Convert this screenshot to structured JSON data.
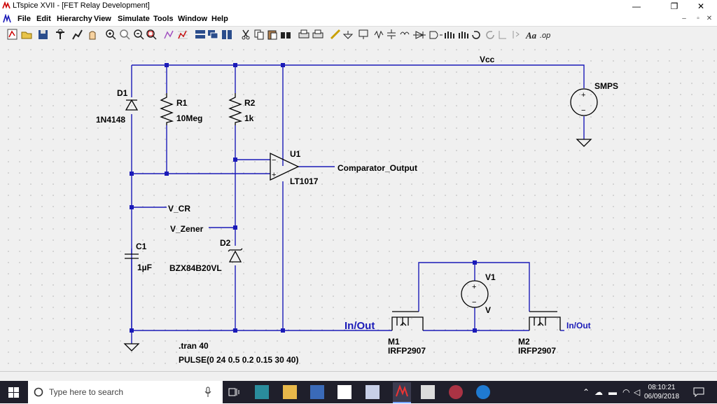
{
  "window": {
    "title": "LTspice XVII - [FET Relay Development]",
    "minimize": "—",
    "maximize": "❐",
    "close": "✕"
  },
  "menu": {
    "items": [
      "File",
      "Edit",
      "Hierarchy",
      "View",
      "Simulate",
      "Tools",
      "Window",
      "Help"
    ],
    "mdi_minimize": "–",
    "mdi_restore": "▫",
    "mdi_close": "✕"
  },
  "toolbar": {
    "icons": [
      "schematic-icon",
      "open-icon",
      "save-icon",
      "control-panel-icon",
      "run-icon",
      "halt-icon",
      "zoom-in-icon",
      "zoom-pan-icon",
      "zoom-out-icon",
      "zoom-fit-icon",
      "autorange-icon",
      "grid-icon",
      "tile-horizontal-icon",
      "cascade-icon",
      "tile-vertical-icon",
      "cut-icon",
      "copy-icon",
      "paste-icon",
      "find-icon",
      "print-setup-icon",
      "print-icon",
      "wire-icon",
      "ground-icon",
      "label-icon",
      "resistor-icon",
      "capacitor-icon",
      "inductor-icon",
      "diode-icon",
      "component-icon",
      "move-icon",
      "drag-icon",
      "undo-icon",
      "redo-icon",
      "rotate-icon",
      "mirror-icon",
      "text-icon",
      "spice-directive-icon"
    ]
  },
  "schematic": {
    "components": {
      "d1": {
        "ref": "D1",
        "value": "1N4148"
      },
      "r1": {
        "ref": "R1",
        "value": "10Meg"
      },
      "r2": {
        "ref": "R2",
        "value": "1k"
      },
      "u1": {
        "ref": "U1",
        "value": "LT1017"
      },
      "c1": {
        "ref": "C1",
        "value": "1µF"
      },
      "d2": {
        "ref": "D2",
        "value": "BZX84B20VL"
      },
      "smps": {
        "ref": "SMPS"
      },
      "v1": {
        "ref": "V1",
        "value": "V"
      },
      "m1": {
        "ref": "M1",
        "value": "IRFP2907"
      },
      "m2": {
        "ref": "M2",
        "value": "IRFP2907"
      }
    },
    "nets": {
      "vcc": "Vcc",
      "comparator": "Comparator_Output",
      "v_cr": "V_CR",
      "v_zener": "V_Zener",
      "in_out_left": "In/Out",
      "in_out_right": "In/Out"
    },
    "directives": {
      "tran": ".tran 40",
      "pulse": "PULSE(0 24 0.5 0.2 0.15 30 40)"
    },
    "opamp_plus": "+",
    "opamp_minus": "−",
    "source_plus": "+",
    "source_minus": "−"
  },
  "taskbar": {
    "search_placeholder": "Type here to search",
    "time": "08:10:21",
    "date": "06/09/2018"
  },
  "colors": {
    "wire": "#1a1ab8",
    "component": "#000000",
    "canvas": "#f0f0f0"
  }
}
